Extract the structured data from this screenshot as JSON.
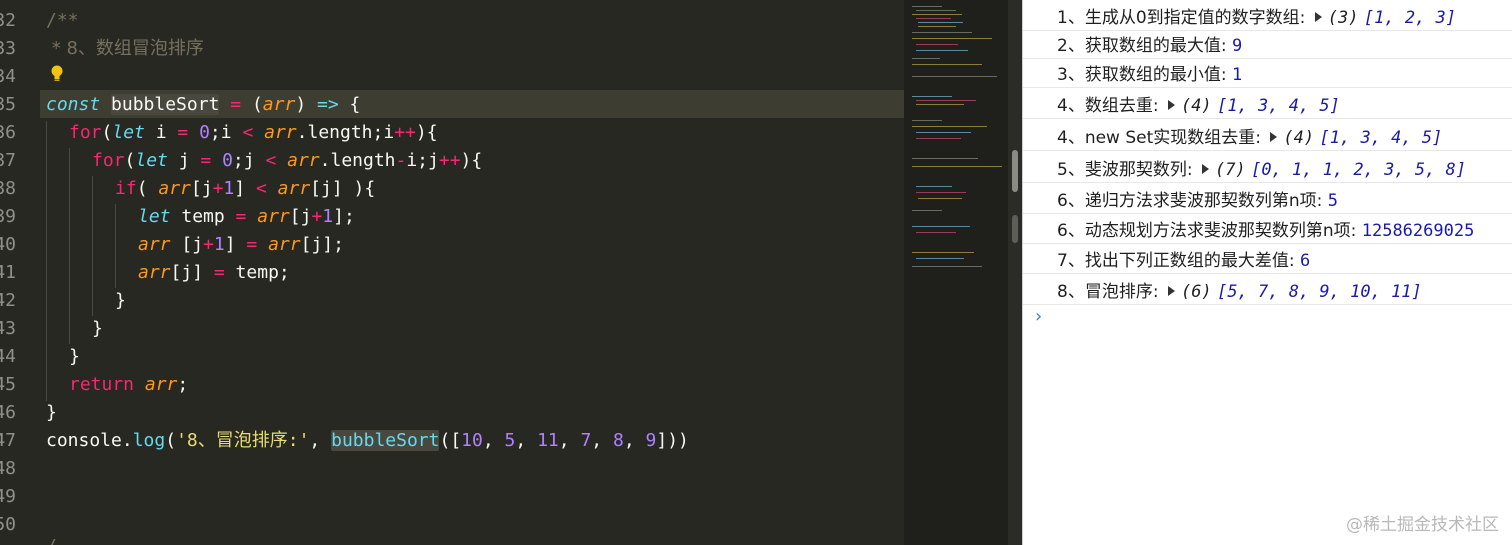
{
  "editor": {
    "line_numbers": [
      "32",
      "33",
      "34",
      "35",
      "36",
      "37",
      "38",
      "39",
      "40",
      "41",
      "42",
      "43",
      "44",
      "45",
      "46",
      "47",
      "48",
      "49",
      "50"
    ],
    "code": {
      "l32": "/**",
      "l33": " * 8、数组冒泡排序",
      "l35": {
        "const": "const",
        "name": "bubbleSo",
        "name2": "rt",
        "eq": "=",
        "open": "(",
        "arg": "arr",
        "close": ")",
        "arrow": "=>",
        "brace": "{"
      },
      "l36": {
        "for": "for",
        "let": "let",
        "rest1": " i ",
        "eq": "=",
        "zero": "0",
        "semi": ";i ",
        "lt": "<",
        "arr": "arr",
        "tail": ".length;i",
        "inc": "++",
        "end": "){"
      },
      "l37": {
        "for": "for",
        "let": "let",
        "rest1": " j ",
        "eq": "=",
        "zero": "0",
        "semi": ";j ",
        "lt": "<",
        "arr": "arr",
        "tail": ".length",
        "minus": "-",
        "tail2": "i;j",
        "inc": "++",
        "end": "){"
      },
      "l38": {
        "if": "if",
        "p1": "( ",
        "arr": "arr",
        "p2": "[j",
        "plus": "+",
        "one": "1",
        "p3": "] ",
        "lt": "<",
        "arr2": "arr",
        "p4": "[j] ){"
      },
      "l39": {
        "let": "let",
        "p1": " temp ",
        "eq": "=",
        "arr": "arr",
        "p2": "[j",
        "plus": "+",
        "one": "1",
        "p3": "];"
      },
      "l40": {
        "arr": "arr",
        "p1": " [j",
        "plus": "+",
        "one": "1",
        "p2": "] ",
        "eq": "=",
        "arr2": "arr",
        "p3": "[j];"
      },
      "l41": {
        "arr": "arr",
        "p1": "[j] ",
        "eq": "=",
        "p2": " temp;"
      },
      "l42": "}",
      "l43": "}",
      "l44": "}",
      "l45": {
        "ret": "return",
        "arr": "arr",
        "semi": ";"
      },
      "l46": "}",
      "l47": {
        "console": "console.",
        "log": "log",
        "p1": "(",
        "str": "'8、冒泡排序:'",
        "p2": ", ",
        "fn": "bubbleSort",
        "p3": "([",
        "n1": "10",
        "c1": ", ",
        "n2": "5",
        "c2": ", ",
        "n3": "11",
        "c3": ", ",
        "n4": "7",
        "c4": ", ",
        "n5": "8",
        "c5": ", ",
        "n6": "9",
        "p4": "]))"
      },
      "l50_partial": "/"
    }
  },
  "console": {
    "rows": [
      {
        "label": "1、生成从0到指定值的数字数组: ",
        "len": "(3)",
        "arr": "[1, 2, 3]"
      },
      {
        "label": "2、获取数组的最大值: ",
        "value": "9"
      },
      {
        "label": "3、获取数组的最小值: ",
        "value": "1"
      },
      {
        "label": "4、数组去重: ",
        "len": "(4)",
        "arr": "[1, 3, 4, 5]"
      },
      {
        "label": "4、new Set实现数组去重: ",
        "len": "(4)",
        "arr": "[1, 3, 4, 5]"
      },
      {
        "label": "5、斐波那契数列: ",
        "len": "(7)",
        "arr": "[0, 1, 1, 2, 3, 5, 8]"
      },
      {
        "label": "6、递归方法求斐波那契数列第n项: ",
        "value": "5"
      },
      {
        "label": "6、动态规划方法求斐波那契数列第n项: ",
        "value": "12586269025"
      },
      {
        "label": "7、找出下列正数组的最大差值: ",
        "value": "6"
      },
      {
        "label": "8、冒泡排序: ",
        "len": "(6)",
        "arr": "[5, 7, 8, 9, 10, 11]"
      }
    ],
    "prompt": "›",
    "watermark": "@稀土掘金技术社区"
  }
}
